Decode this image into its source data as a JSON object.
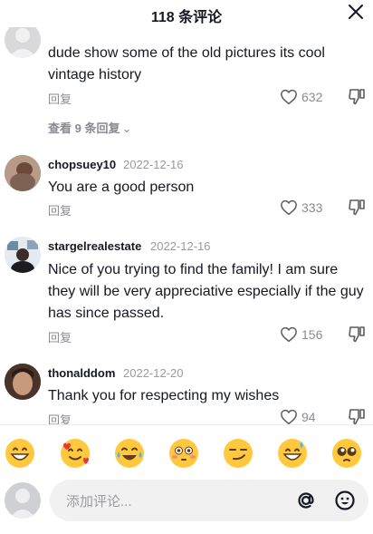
{
  "header": {
    "title": "118 条评论"
  },
  "comments": [
    {
      "text": "dude show some of the old pictures its cool vintage history",
      "reply_label": "回复",
      "likes": "632",
      "view_replies": "查看 9 条回复",
      "view_replies_chevron": "⌄"
    },
    {
      "username": "chopsuey10",
      "date": "2022-12-16",
      "text": "You are a good person",
      "reply_label": "回复",
      "likes": "333"
    },
    {
      "username": "stargelrealestate",
      "date": "2022-12-16",
      "text": "Nice of you trying to find the family! I am sure they will be very appreciative especially if the guy has since passed.",
      "reply_label": "回复",
      "likes": "156"
    },
    {
      "username": "thonalddom",
      "date": "2022-12-20",
      "text": "Thank you for respecting my wishes",
      "reply_label": "回复",
      "likes": "94"
    }
  ],
  "emoji_bar": [
    "grinning-face",
    "smiling-face-with-hearts",
    "tears-of-joy",
    "flushed-face",
    "smirking-face",
    "grinning-sweat",
    "pleading-face"
  ],
  "composer": {
    "placeholder": "添加评论..."
  },
  "colors": {
    "text": "#161823",
    "muted": "#8a8b91",
    "date": "#9a9ba0",
    "emoji": "#ffc83d"
  }
}
